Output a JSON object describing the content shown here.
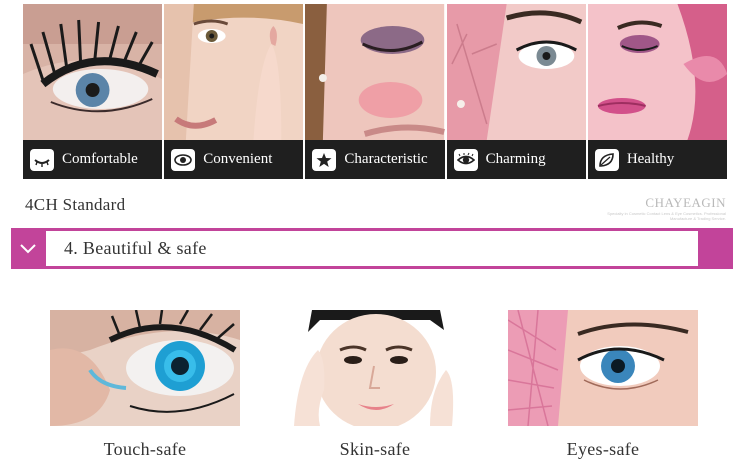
{
  "features": [
    {
      "label": "Comfortable",
      "icon": "eye-closed-icon"
    },
    {
      "label": "Convenient",
      "icon": "eye-camera-icon"
    },
    {
      "label": "Characteristic",
      "icon": "star-icon"
    },
    {
      "label": "Charming",
      "icon": "eye-open-icon"
    },
    {
      "label": "Healthy",
      "icon": "leaf-icon"
    }
  ],
  "standard": {
    "title": "4CH Standard"
  },
  "brand": {
    "name": "CHAYEAGIN",
    "tagline": "Specialty in Cosmetic Contact Lens & Eye Cosmetics. Professional Manufacture & Trading Service."
  },
  "section": {
    "title": "4. Beautiful & safe",
    "accent_color": "#c2449a"
  },
  "safety": [
    {
      "label": "Touch-safe"
    },
    {
      "label": "Skin-safe"
    },
    {
      "label": "Eyes-safe"
    }
  ]
}
